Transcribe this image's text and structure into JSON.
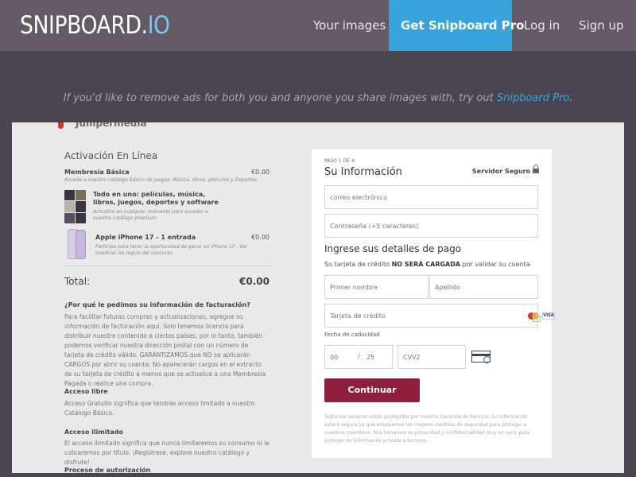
{
  "header": {
    "logo_main": "SNIPBOARD.",
    "logo_suffix": "IO",
    "nav": {
      "your_images": "Your images",
      "get_pro": "Get Snipboard Pro",
      "login": "Log in",
      "signup": "Sign up"
    },
    "colors": {
      "topbar": "#625b66",
      "pro_button": "#36a4db",
      "background": "#4b4550"
    }
  },
  "promo": {
    "text": "If you'd like to remove ads for both you and anyone you share images with, try out ",
    "link": "Snipboard Pro",
    "end": "."
  },
  "screenshot": {
    "brand": "Jumpermedia",
    "left": {
      "title": "Activación En Línea",
      "items": [
        {
          "name": "Membresía Básica",
          "price": "€0.00",
          "note": "Accede a nuestro catálogo básico de juegos, Música, libros, películas y Deportes"
        },
        {
          "name": "Todo en uno: películas, música, libros, juegos, deportes y software",
          "note": "Actualice en cualquier momento para acceder a nuestro catálogo premium"
        },
        {
          "name": "Apple iPhone 17 - 1 entrada",
          "price": "€0.00",
          "note": "Participa para tener la oportunidad de ganar un iPhone 17 - Ver nuestras las reglas del concurso"
        }
      ],
      "total_label": "Total:",
      "total_value": "€0.00",
      "sections": [
        {
          "heading": "¿Por qué le pedimos su información de facturación?",
          "body": "Para facilitar futuras compras y actualizaciones, agregue su información de facturación aquí. Solo tenemos licencia para distribuir nuestro contenido a ciertos países, por lo tanto, también podemos verificar nuestra dirección postal con un número de tarjeta de crédito válido. GARANTIZAMOS que NO se aplicarán CARGOS por abrir su cuenta. No aparecerán cargos en el extracto de su tarjeta de crédito a menos que se actualice a una Membresía Pagada o realice una compra."
        },
        {
          "heading": "Acceso libre",
          "body": "Acceso Gratuito significa que tendrás acceso limitado a nuestro Catálogo Básico."
        },
        {
          "heading": "Acceso ilimitado",
          "body": "El acceso ilimitado significa que nunca limitaremos su consumo ni le cobraremos por título. ¡Regístrese, explore nuestro catálogo y disfrute!"
        },
        {
          "heading": "Proceso de autorización",
          "body": ""
        }
      ]
    },
    "form": {
      "step": "PASO 1 DE 4",
      "title": "Su Información",
      "secure": "Servidor Seguro",
      "email_placeholder": "correo electrónico",
      "password_placeholder": "Contraseña (+5 caracteres)",
      "payment_title": "Ingrese sus detalles de pago",
      "payment_note_pre": "Su tarjeta de crédito ",
      "payment_note_bold": "NO SERÁ CARGADA",
      "payment_note_post": " por validar su cuenta",
      "first_name_placeholder": "Primer nombre",
      "last_name_placeholder": "Apellido",
      "card_placeholder": "Tarjeta de crédito",
      "visa": "VISA",
      "expiry_label": "Fecha de caducidad",
      "month_placeholder": "00",
      "slash": "/",
      "year_placeholder": "25",
      "cvv_placeholder": "CVV2",
      "submit": "Continuar",
      "legal": "Todos los usuarios están protegidos por nuestra Garantía de Servicio. Su información estará segura ya que empleamos las mejores medidas de seguridad para proteger a nuestros miembros. Nos tomamos su privacidad y confidencialidad muy en serio para proteger su información privada a terceros.",
      "colors": {
        "submit": "#8e1c3d"
      }
    }
  }
}
